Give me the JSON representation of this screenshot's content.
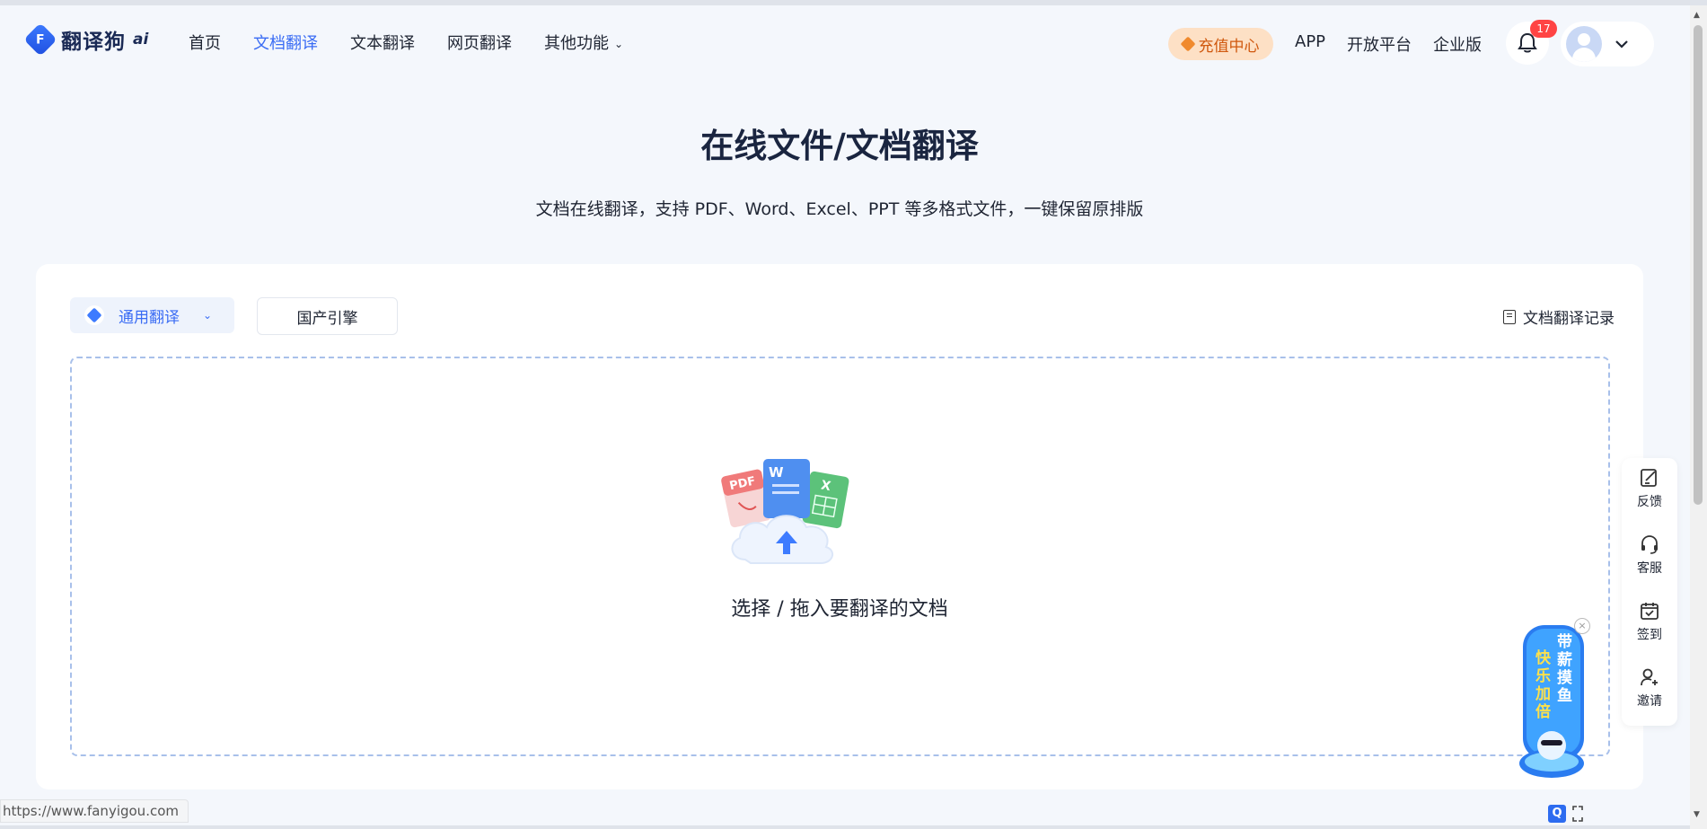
{
  "logo": {
    "text": "翻译狗",
    "ai": "ai",
    "mark": "F"
  },
  "nav": {
    "items": [
      {
        "label": "首页"
      },
      {
        "label": "文档翻译"
      },
      {
        "label": "文本翻译"
      },
      {
        "label": "网页翻译"
      },
      {
        "label": "其他功能"
      }
    ]
  },
  "header": {
    "recharge": "充值中心",
    "links": [
      "APP",
      "开放平台",
      "企业版"
    ],
    "notification_count": "17"
  },
  "hero": {
    "title": "在线文件/文档翻译",
    "subtitle": "文档在线翻译，支持 PDF、Word、Excel、PPT 等多格式文件，一键保留原排版"
  },
  "card": {
    "engine_label": "通用翻译",
    "domestic_label": "国产引擎",
    "records_label": "文档翻译记录",
    "drop_text": "选择 / 拖入要翻译的文档",
    "file_badges": {
      "pdf": "PDF",
      "word": "W",
      "excel": "X"
    }
  },
  "side_toolbar": {
    "items": [
      {
        "label": "反馈",
        "icon": "feedback-icon"
      },
      {
        "label": "客服",
        "icon": "headset-icon"
      },
      {
        "label": "签到",
        "icon": "calendar-check-icon"
      },
      {
        "label": "邀请",
        "icon": "add-user-icon"
      }
    ]
  },
  "promo": {
    "line1": "带薪摸鱼",
    "line2": "快乐加倍"
  },
  "status_bar": {
    "url": "https://www.fanyigou.com"
  },
  "colors": {
    "accent": "#3a6cf4",
    "recharge_bg": "#fde0c5",
    "recharge_text": "#d0580e",
    "badge": "#ff4444"
  }
}
